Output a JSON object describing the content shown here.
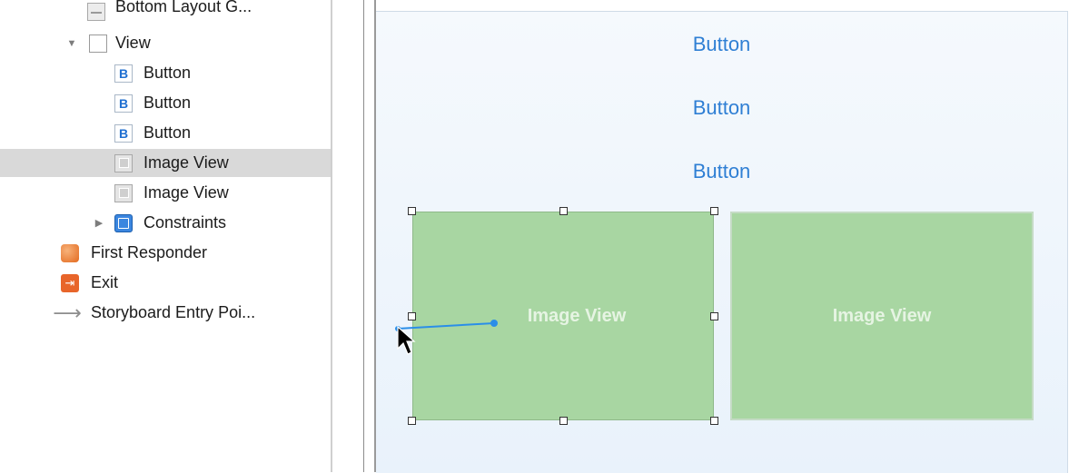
{
  "outline": {
    "items": [
      {
        "label": "Bottom Layout G...",
        "icon": "layout-guide-icon"
      },
      {
        "label": "View",
        "icon": "view-icon",
        "disclosure": "expanded"
      },
      {
        "label": "Button",
        "icon": "button-icon"
      },
      {
        "label": "Button",
        "icon": "button-icon"
      },
      {
        "label": "Button",
        "icon": "button-icon"
      },
      {
        "label": "Image View",
        "icon": "image-view-icon",
        "selected": true
      },
      {
        "label": "Image View",
        "icon": "image-view-icon"
      },
      {
        "label": "Constraints",
        "icon": "constraints-icon",
        "disclosure": "collapsed"
      },
      {
        "label": "First Responder",
        "icon": "first-responder-icon"
      },
      {
        "label": "Exit",
        "icon": "exit-icon"
      },
      {
        "label": "Storyboard Entry Poi...",
        "icon": "entry-point-arrow-icon"
      }
    ]
  },
  "canvas": {
    "buttons": [
      {
        "label": "Button"
      },
      {
        "label": "Button"
      },
      {
        "label": "Button"
      }
    ],
    "image_views": [
      {
        "label": "Image View",
        "selected": true
      },
      {
        "label": "Image View"
      }
    ]
  },
  "colors": {
    "button_text": "#2f7fd4",
    "image_view_fill": "#a8d6a2",
    "selection_row": "#d9d9d9",
    "connection_line": "#2a8ee8"
  }
}
